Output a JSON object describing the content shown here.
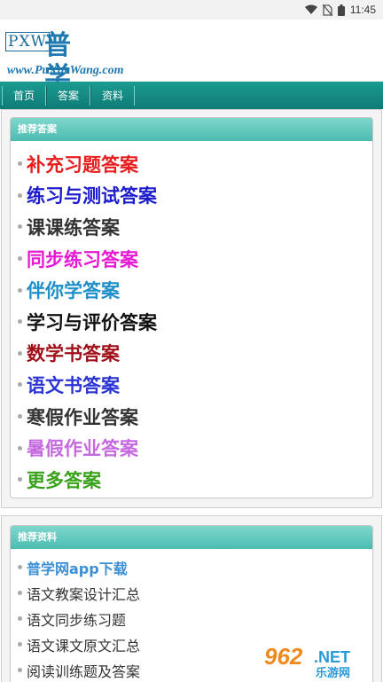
{
  "status": {
    "time": "11:45"
  },
  "logo": {
    "badge": "PXW",
    "name": "普学网",
    "url": "www.PuXueWang.com"
  },
  "nav": {
    "items": [
      "首页",
      "答案",
      "资料"
    ]
  },
  "answers": {
    "title": "推荐答案",
    "items": [
      {
        "label": "补充习题答案",
        "color": "#e61e1e"
      },
      {
        "label": "练习与测试答案",
        "color": "#1c1ccc"
      },
      {
        "label": "课课练答案",
        "color": "#333333"
      },
      {
        "label": "同步练习答案",
        "color": "#e619d2"
      },
      {
        "label": "伴你学答案",
        "color": "#1f8fc9"
      },
      {
        "label": "学习与评价答案",
        "color": "#111111"
      },
      {
        "label": "数学书答案",
        "color": "#a0101a"
      },
      {
        "label": "语文书答案",
        "color": "#2b35d6"
      },
      {
        "label": "寒假作业答案",
        "color": "#333333"
      },
      {
        "label": "暑假作业答案",
        "color": "#c66ae0"
      },
      {
        "label": "更多答案",
        "color": "#3aa11a"
      }
    ]
  },
  "resources": {
    "title": "推荐资料",
    "items": [
      {
        "label": "普学网app下载",
        "color": "#3b8fd6",
        "bold": true
      },
      {
        "label": "语文教案设计汇总",
        "color": "#333333",
        "bold": false
      },
      {
        "label": "语文同步练习题",
        "color": "#333333",
        "bold": false
      },
      {
        "label": "语文课文原文汇总",
        "color": "#333333",
        "bold": false
      },
      {
        "label": "阅读训练题及答案",
        "color": "#333333",
        "bold": false
      }
    ]
  },
  "watermark": {
    "num": "962",
    "net": ".NET",
    "cn": "乐游网"
  }
}
